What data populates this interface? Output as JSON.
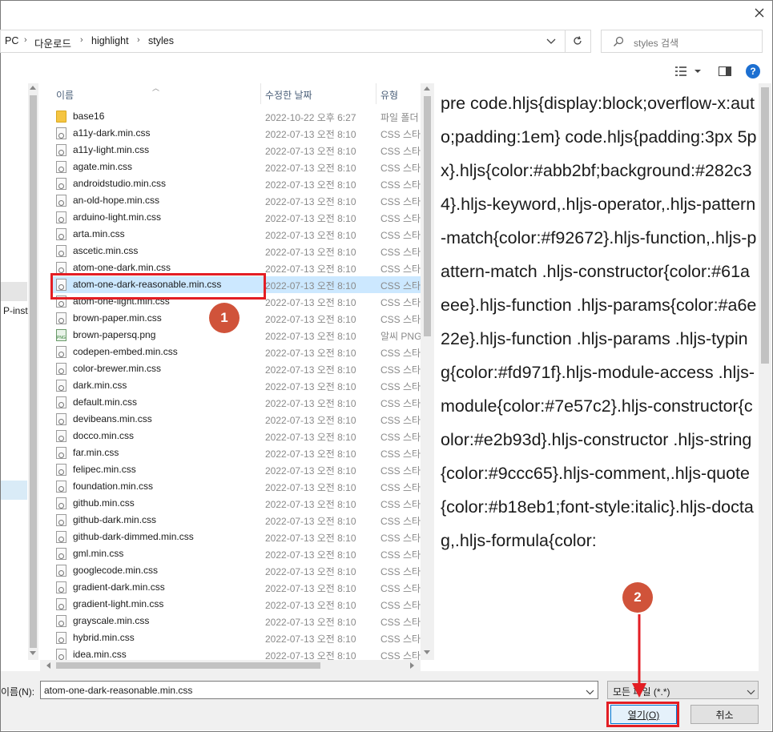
{
  "address": {
    "crumbs": [
      "PC",
      "다운로드",
      "highlight",
      "styles"
    ],
    "search_placeholder": "styles 검색"
  },
  "columns": {
    "name": "이름",
    "date": "수정한 날짜",
    "type": "유형"
  },
  "files": [
    {
      "name": "base16",
      "date": "2022-10-22 오후 6:27",
      "type": "파일 폴더",
      "kind": "folder"
    },
    {
      "name": "a11y-dark.min.css",
      "date": "2022-07-13 오전 8:10",
      "type": "CSS 스타일 시트",
      "kind": "css"
    },
    {
      "name": "a11y-light.min.css",
      "date": "2022-07-13 오전 8:10",
      "type": "CSS 스타일 시트",
      "kind": "css"
    },
    {
      "name": "agate.min.css",
      "date": "2022-07-13 오전 8:10",
      "type": "CSS 스타일 시트",
      "kind": "css"
    },
    {
      "name": "androidstudio.min.css",
      "date": "2022-07-13 오전 8:10",
      "type": "CSS 스타일 시트",
      "kind": "css"
    },
    {
      "name": "an-old-hope.min.css",
      "date": "2022-07-13 오전 8:10",
      "type": "CSS 스타일 시트",
      "kind": "css"
    },
    {
      "name": "arduino-light.min.css",
      "date": "2022-07-13 오전 8:10",
      "type": "CSS 스타일 시트",
      "kind": "css"
    },
    {
      "name": "arta.min.css",
      "date": "2022-07-13 오전 8:10",
      "type": "CSS 스타일 시트",
      "kind": "css"
    },
    {
      "name": "ascetic.min.css",
      "date": "2022-07-13 오전 8:10",
      "type": "CSS 스타일 시트",
      "kind": "css"
    },
    {
      "name": "atom-one-dark.min.css",
      "date": "2022-07-13 오전 8:10",
      "type": "CSS 스타일 시트",
      "kind": "css"
    },
    {
      "name": "atom-one-dark-reasonable.min.css",
      "date": "2022-07-13 오전 8:10",
      "type": "CSS 스타일 시트",
      "kind": "css",
      "selected": true
    },
    {
      "name": "atom-one-light.min.css",
      "date": "2022-07-13 오전 8:10",
      "type": "CSS 스타일 시트",
      "kind": "css"
    },
    {
      "name": "brown-paper.min.css",
      "date": "2022-07-13 오전 8:10",
      "type": "CSS 스타일 시트",
      "kind": "css"
    },
    {
      "name": "brown-papersq.png",
      "date": "2022-07-13 오전 8:10",
      "type": "알씨 PNG 파일",
      "kind": "png"
    },
    {
      "name": "codepen-embed.min.css",
      "date": "2022-07-13 오전 8:10",
      "type": "CSS 스타일 시트",
      "kind": "css"
    },
    {
      "name": "color-brewer.min.css",
      "date": "2022-07-13 오전 8:10",
      "type": "CSS 스타일 시트",
      "kind": "css"
    },
    {
      "name": "dark.min.css",
      "date": "2022-07-13 오전 8:10",
      "type": "CSS 스타일 시트",
      "kind": "css"
    },
    {
      "name": "default.min.css",
      "date": "2022-07-13 오전 8:10",
      "type": "CSS 스타일 시트",
      "kind": "css"
    },
    {
      "name": "devibeans.min.css",
      "date": "2022-07-13 오전 8:10",
      "type": "CSS 스타일 시트",
      "kind": "css"
    },
    {
      "name": "docco.min.css",
      "date": "2022-07-13 오전 8:10",
      "type": "CSS 스타일 시트",
      "kind": "css"
    },
    {
      "name": "far.min.css",
      "date": "2022-07-13 오전 8:10",
      "type": "CSS 스타일 시트",
      "kind": "css"
    },
    {
      "name": "felipec.min.css",
      "date": "2022-07-13 오전 8:10",
      "type": "CSS 스타일 시트",
      "kind": "css"
    },
    {
      "name": "foundation.min.css",
      "date": "2022-07-13 오전 8:10",
      "type": "CSS 스타일 시트",
      "kind": "css"
    },
    {
      "name": "github.min.css",
      "date": "2022-07-13 오전 8:10",
      "type": "CSS 스타일 시트",
      "kind": "css"
    },
    {
      "name": "github-dark.min.css",
      "date": "2022-07-13 오전 8:10",
      "type": "CSS 스타일 시트",
      "kind": "css"
    },
    {
      "name": "github-dark-dimmed.min.css",
      "date": "2022-07-13 오전 8:10",
      "type": "CSS 스타일 시트",
      "kind": "css"
    },
    {
      "name": "gml.min.css",
      "date": "2022-07-13 오전 8:10",
      "type": "CSS 스타일 시트",
      "kind": "css"
    },
    {
      "name": "googlecode.min.css",
      "date": "2022-07-13 오전 8:10",
      "type": "CSS 스타일 시트",
      "kind": "css"
    },
    {
      "name": "gradient-dark.min.css",
      "date": "2022-07-13 오전 8:10",
      "type": "CSS 스타일 시트",
      "kind": "css"
    },
    {
      "name": "gradient-light.min.css",
      "date": "2022-07-13 오전 8:10",
      "type": "CSS 스타일 시트",
      "kind": "css"
    },
    {
      "name": "grayscale.min.css",
      "date": "2022-07-13 오전 8:10",
      "type": "CSS 스타일 시트",
      "kind": "css"
    },
    {
      "name": "hybrid.min.css",
      "date": "2022-07-13 오전 8:10",
      "type": "CSS 스타일 시트",
      "kind": "css"
    },
    {
      "name": "idea.min.css",
      "date": "2022-07-13 오전 8:10",
      "type": "CSS 스타일 시트",
      "kind": "css"
    }
  ],
  "sidebar_fragment": "P-inst",
  "preview_text": "pre code.hljs{display:block;overflow-x:auto;padding:1em} code.hljs{padding:3px 5px}.hljs{color:#abb2bf;background:#282c34}.hljs-keyword,.hljs-operator,.hljs-pattern-match{color:#f92672}.hljs-function,.hljs-pattern-match .hljs-constructor{color:#61aeee}.hljs-function .hljs-params{color:#a6e22e}.hljs-function .hljs-params .hljs-typing{color:#fd971f}.hljs-module-access .hljs-module{color:#7e57c2}.hljs-constructor{color:#e2b93d}.hljs-constructor .hljs-string{color:#9ccc65}.hljs-comment,.hljs-quote{color:#b18eb1;font-style:italic}.hljs-doctag,.hljs-formula{color:",
  "filename": {
    "label": "이름(N):",
    "value": "atom-one-dark-reasonable.min.css"
  },
  "filetype": {
    "value": "모든 파일 (*.*)"
  },
  "buttons": {
    "open": "열기(O)",
    "cancel": "취소"
  },
  "annotations": {
    "step1": "1",
    "step2": "2"
  },
  "colors": {
    "selection": "#cce8ff",
    "annotation_red": "#e31e24",
    "badge": "#d0533a"
  }
}
